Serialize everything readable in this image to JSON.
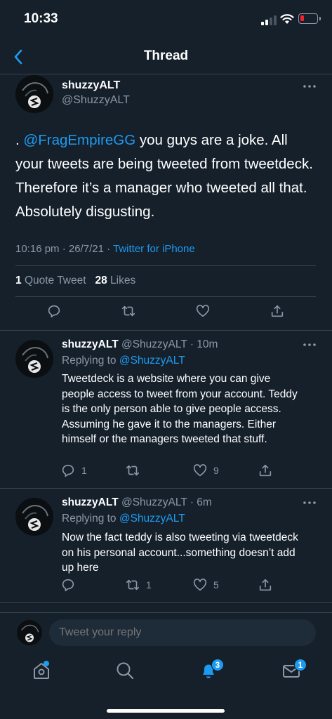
{
  "status_bar": {
    "time": "10:33"
  },
  "header": {
    "title": "Thread"
  },
  "main_tweet": {
    "name": "shuzzyALT",
    "handle": "@ShuzzyALT",
    "text_prefix": ". ",
    "mention": "@FragEmpireGG",
    "text": " you guys are a joke. All your tweets are being tweeted from tweetdeck. Therefore it’s a manager who tweeted all that. Absolutely disgusting.",
    "time": "10:16 pm · 26/7/21 · ",
    "source": "Twitter for iPhone",
    "quote_count": "1",
    "quote_label": "Quote Tweet",
    "likes_count": "28",
    "likes_label": "Likes"
  },
  "replies": [
    {
      "name": "shuzzyALT",
      "handle_time": "@ShuzzyALT · 10m",
      "replying_label": "Replying to ",
      "replying_to": "@ShuzzyALT",
      "text": "Tweetdeck is a website where you can give people access to tweet from your account. Teddy is the only person able to give people access. Assuming he gave it to the managers. Either himself or the managers tweeted that stuff.",
      "reply_count": "1",
      "retweet_count": "",
      "like_count": "9"
    },
    {
      "name": "shuzzyALT",
      "handle_time": "@ShuzzyALT · 6m",
      "replying_label": "Replying to ",
      "replying_to": "@ShuzzyALT",
      "text": "Now the fact teddy is also tweeting via tweetdeck on his personal account...something doesn’t add up here",
      "reply_count": "",
      "retweet_count": "1",
      "like_count": "5"
    }
  ],
  "compose": {
    "placeholder": "Tweet your reply"
  },
  "tab_bar": {
    "notifications_badge": "3",
    "messages_badge": "1"
  },
  "colors": {
    "background": "#15202b",
    "accent": "#1d9bf0",
    "muted": "#8b98a5",
    "divider": "#38444d"
  },
  "icons": [
    "chevron-left-icon",
    "more-icon",
    "reply-icon",
    "retweet-icon",
    "like-icon",
    "share-icon",
    "home-icon",
    "search-icon",
    "bell-icon",
    "mail-icon"
  ]
}
